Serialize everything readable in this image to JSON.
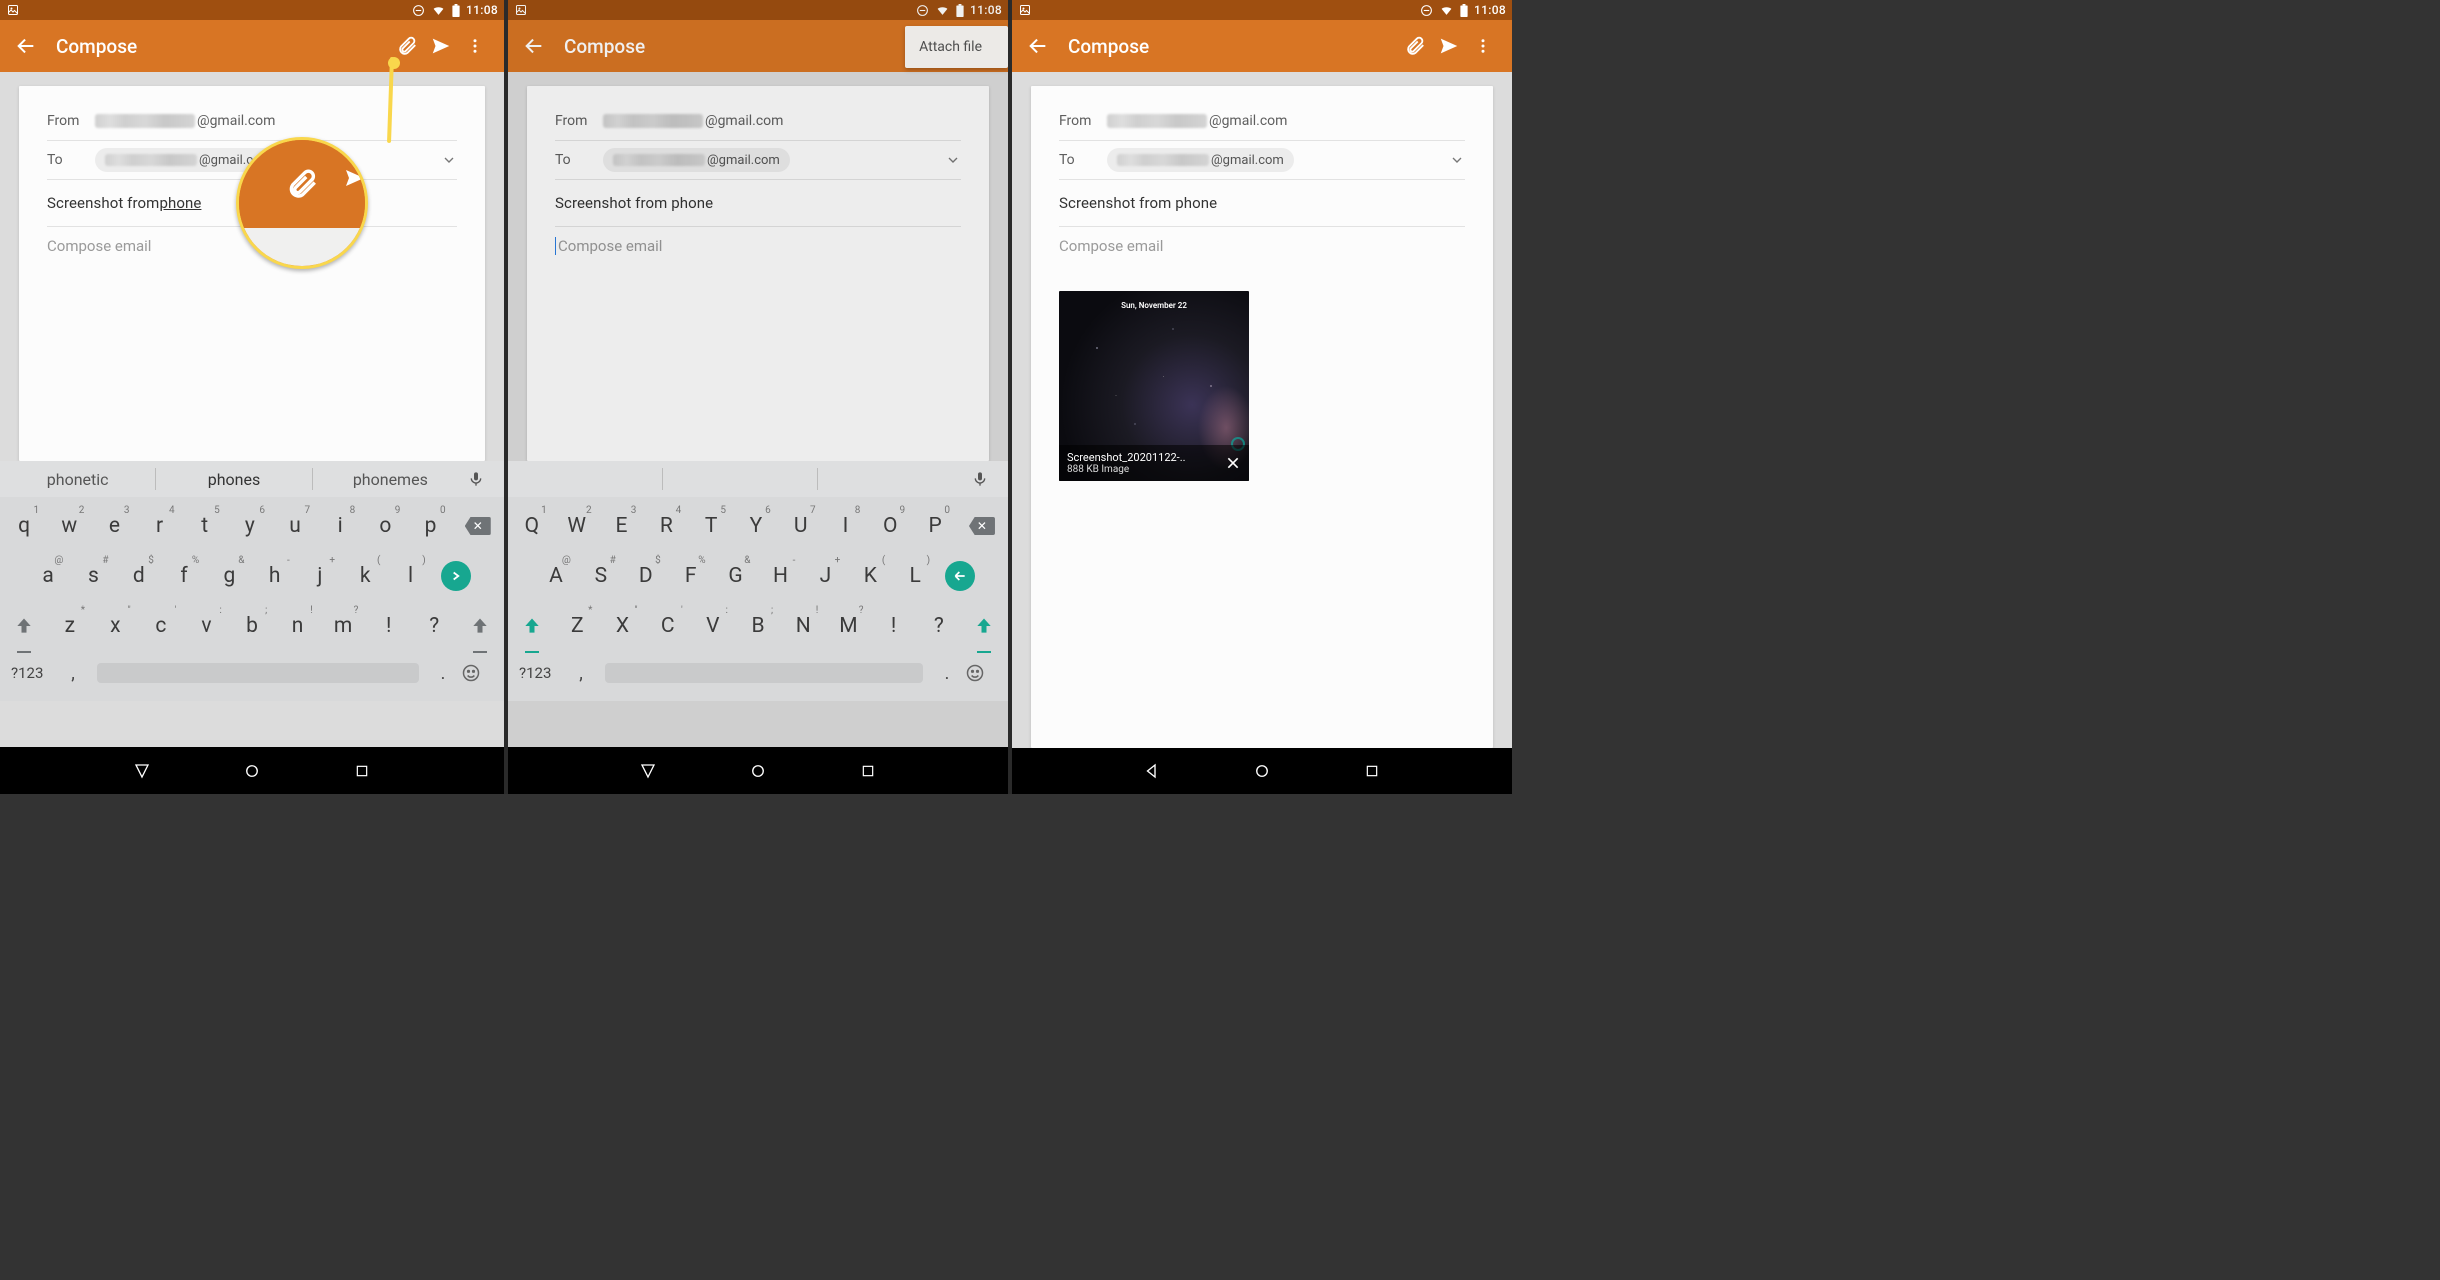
{
  "status": {
    "time": "11:08"
  },
  "appbar": {
    "title": "Compose"
  },
  "compose": {
    "from_label": "From",
    "to_label": "To",
    "from_suffix": "@gmail.com",
    "to_suffix": "@gmail.com",
    "subject_plain": "Screenshot from phone",
    "subject_prefix": "Screenshot from ",
    "subject_underlined": "phone",
    "body_placeholder": "Compose email"
  },
  "menu": {
    "attach_file": "Attach file"
  },
  "suggestions": {
    "a": "phonetic",
    "b": "phones",
    "c": "phonemes",
    "dots": "..."
  },
  "keyboard": {
    "row1_lower": [
      "q",
      "w",
      "e",
      "r",
      "t",
      "y",
      "u",
      "i",
      "o",
      "p"
    ],
    "row1_upper": [
      "Q",
      "W",
      "E",
      "R",
      "T",
      "Y",
      "U",
      "I",
      "O",
      "P"
    ],
    "row1_sup": [
      "1",
      "2",
      "3",
      "4",
      "5",
      "6",
      "7",
      "8",
      "9",
      "0"
    ],
    "row2_lower": [
      "a",
      "s",
      "d",
      "f",
      "g",
      "h",
      "j",
      "k",
      "l"
    ],
    "row2_upper": [
      "A",
      "S",
      "D",
      "F",
      "G",
      "H",
      "J",
      "K",
      "L"
    ],
    "row2_sup": [
      "@",
      "#",
      "$",
      "%",
      "&",
      "-",
      "+",
      "(",
      ")"
    ],
    "row3_lower": [
      "z",
      "x",
      "c",
      "v",
      "b",
      "n",
      "m",
      "!",
      "?"
    ],
    "row3_upper": [
      "Z",
      "X",
      "C",
      "V",
      "B",
      "N",
      "M",
      "!",
      "?"
    ],
    "row3_sup": [
      "*",
      "\"",
      "'",
      ":",
      ";",
      "!",
      "?",
      "",
      ""
    ],
    "symbols_key": "?123",
    "comma": ",",
    "period": "."
  },
  "attachment": {
    "date_overlay": "Sun, November 22",
    "filename": "Screenshot_20201122-..",
    "size_line": "888 KB Image"
  },
  "colors": {
    "appbar": "#d87524",
    "status": "#9f4f10",
    "accent_yellow": "#f9d74c",
    "enter_green": "#17a790"
  }
}
